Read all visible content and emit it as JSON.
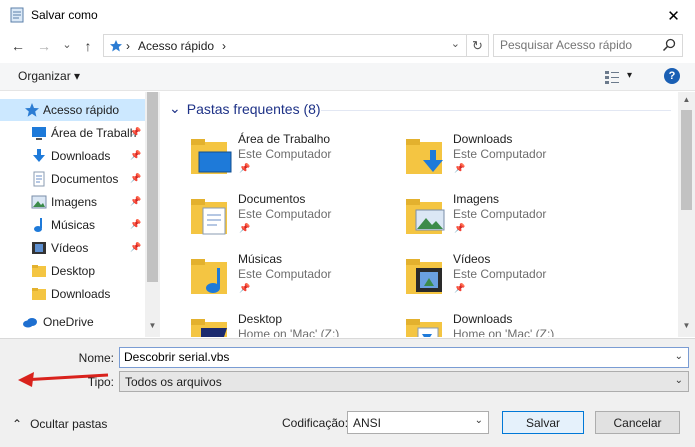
{
  "window": {
    "title": "Salvar como",
    "close_glyph": "✕"
  },
  "address": {
    "back_glyph": "←",
    "forward_glyph": "→",
    "recent_glyph": "⌄",
    "up_glyph": "↑",
    "path_sep": "›",
    "path": "Acesso rápido",
    "path_sep_end": "›",
    "dropdown_glyph": "⌄",
    "refresh_glyph": "↻"
  },
  "search": {
    "placeholder": "Pesquisar Acesso rápido"
  },
  "toolbar": {
    "organize_label": "Organizar ▾",
    "view_glyph": "▾",
    "help_glyph": "?"
  },
  "nav": {
    "items": [
      {
        "label": "Acesso rápido",
        "icon": "star-icon",
        "pinned": false,
        "selected": true
      },
      {
        "label": "Área de Trabalh",
        "icon": "desktop-icon",
        "pinned": true
      },
      {
        "label": "Downloads",
        "icon": "download-icon",
        "pinned": true
      },
      {
        "label": "Documentos",
        "icon": "document-icon",
        "pinned": true
      },
      {
        "label": "Imagens",
        "icon": "picture-icon",
        "pinned": true
      },
      {
        "label": "Músicas",
        "icon": "music-icon",
        "pinned": true
      },
      {
        "label": "Vídeos",
        "icon": "video-icon",
        "pinned": true
      },
      {
        "label": "Desktop",
        "icon": "folder-icon",
        "pinned": false
      },
      {
        "label": "Downloads",
        "icon": "folder-icon",
        "pinned": false
      },
      {
        "label": "OneDrive",
        "icon": "cloud-icon",
        "pinned": false
      }
    ],
    "pin_glyph": "📌"
  },
  "content": {
    "group_label": "Pastas frequentes (8)",
    "group_chevron": "⌄",
    "tiles": [
      {
        "name": "Área de Trabalho",
        "sub": "Este Computador",
        "icon": "desktop-folder-icon"
      },
      {
        "name": "Downloads",
        "sub": "Este Computador",
        "icon": "downloads-folder-icon"
      },
      {
        "name": "Documentos",
        "sub": "Este Computador",
        "icon": "documents-folder-icon"
      },
      {
        "name": "Imagens",
        "sub": "Este Computador",
        "icon": "pictures-folder-icon"
      },
      {
        "name": "Músicas",
        "sub": "Este Computador",
        "icon": "music-folder-icon"
      },
      {
        "name": "Vídeos",
        "sub": "Este Computador",
        "icon": "videos-folder-icon"
      },
      {
        "name": "Desktop",
        "sub": "Home on 'Mac' (Z:)",
        "icon": "mac-desktop-folder-icon"
      },
      {
        "name": "Downloads",
        "sub": "Home on 'Mac' (Z:)",
        "icon": "mac-downloads-folder-icon"
      }
    ]
  },
  "form": {
    "name_label": "Nome:",
    "name_value": "Descobrir serial.vbs",
    "type_label": "Tipo:",
    "type_value": "Todos os arquivos",
    "chevron": "⌄"
  },
  "footer": {
    "hide_folders_label": "Ocultar pastas",
    "hide_glyph": "⌃",
    "encoding_label": "Codificação:",
    "encoding_value": "ANSI",
    "save_label": "Salvar",
    "cancel_label": "Cancelar"
  },
  "colors": {
    "accent": "#0078d7",
    "selected_bg": "#cce8ff",
    "folder_yellow": "#f4c542",
    "arrow_red": "#d9221c"
  }
}
